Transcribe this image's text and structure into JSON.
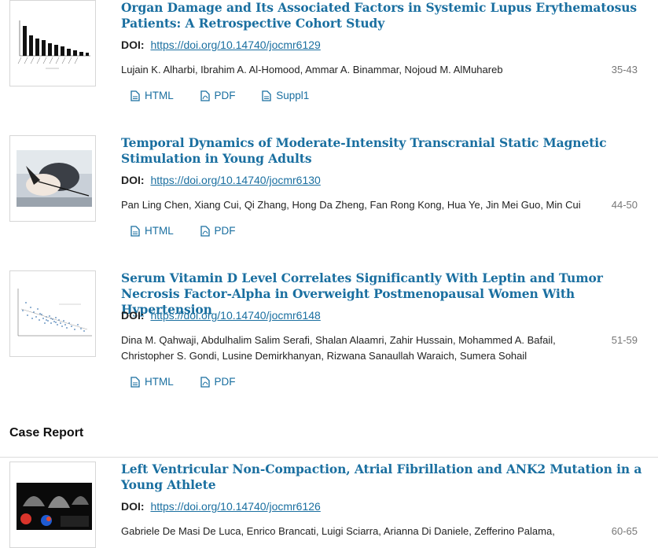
{
  "articles": [
    {
      "title": "Organ Damage and Its Associated Factors in Systemic Lupus Erythematosus Patients: A Retrospective Cohort Study",
      "doi_label": "DOI:",
      "doi": "https://doi.org/10.14740/jocmr6129",
      "authors": "Lujain K. Alharbi, Ibrahim A. Al-Homood, Ammar A. Binammar, Nojoud M. AlMuhareb",
      "pages": "35-43",
      "links": [
        "HTML",
        "PDF",
        "Suppl1"
      ]
    },
    {
      "title": "Temporal Dynamics of Moderate-Intensity Transcranial Static Magnetic Stimulation in Young Adults",
      "doi_label": "DOI:",
      "doi": "https://doi.org/10.14740/jocmr6130",
      "authors": "Pan Ling Chen, Xiang Cui, Qi Zhang, Hong Da Zheng, Fan Rong Kong, Hua Ye, Jin Mei Guo, Min Cui",
      "pages": "44-50",
      "links": [
        "HTML",
        "PDF"
      ]
    },
    {
      "title": "Serum Vitamin D Level Correlates Significantly With Leptin and Tumor Necrosis Factor-Alpha in Overweight Postmenopausal Women With Hypertension",
      "doi_label": "DOI:",
      "doi": "https://doi.org/10.14740/jocmr6148",
      "authors": "Dina M. Qahwaji, Abdulhalim Salim Serafi, Shalan Alaamri, Zahir Hussain, Mohammed A. Bafail, Christopher S. Gondi, Lusine Demirkhanyan, Rizwana Sanaullah Waraich, Sumera Sohail",
      "pages": "51-59",
      "links": [
        "HTML",
        "PDF"
      ]
    }
  ],
  "section": {
    "title": "Case Report"
  },
  "case_article": {
    "title": "Left Ventricular Non-Compaction, Atrial Fibrillation and ANK2 Mutation in a Young Athlete",
    "doi_label": "DOI:",
    "doi": "https://doi.org/10.14740/jocmr6126",
    "authors": "Gabriele De Masi De Luca, Enrico Brancati, Luigi Sciarra, Arianna Di Daniele, Zefferino Palama,",
    "pages": "60-65"
  },
  "colors": {
    "link": "#1a6fa0",
    "pages": "#777777"
  },
  "icons": {
    "html": "document-icon",
    "pdf": "pdf-file-icon",
    "suppl": "document-icon"
  }
}
